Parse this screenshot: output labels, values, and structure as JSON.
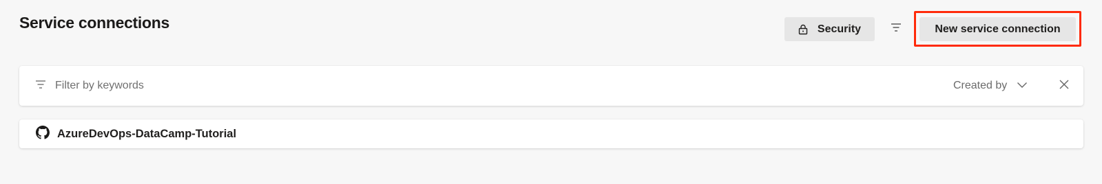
{
  "header": {
    "title": "Service connections",
    "security_label": "Security",
    "new_connection_label": "New service connection"
  },
  "filter_bar": {
    "placeholder": "Filter by keywords",
    "created_by_label": "Created by"
  },
  "connections": [
    {
      "name": "AzureDevOps-DataCamp-Tutorial",
      "icon": "github-icon"
    }
  ],
  "colors": {
    "highlight": "#ff2a0a",
    "button_bg": "#e6e6e6",
    "page_bg": "#f7f7f7"
  }
}
